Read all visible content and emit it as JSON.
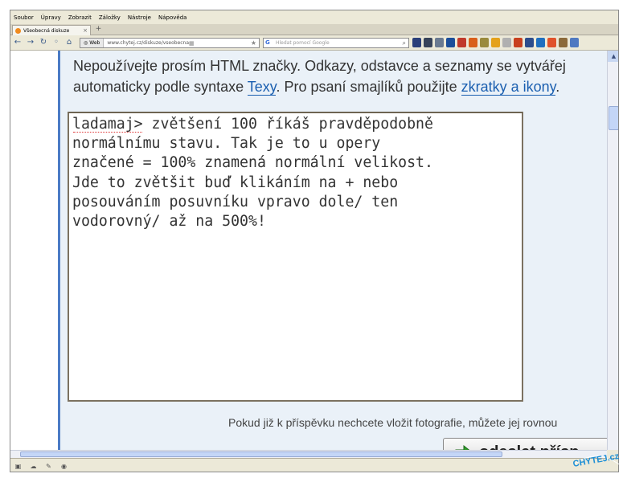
{
  "menu": [
    "Soubor",
    "Úpravy",
    "Zobrazit",
    "Záložky",
    "Nástroje",
    "Nápověda"
  ],
  "tab": {
    "title": "Všeobecná diskuze",
    "close": "×",
    "new": "+"
  },
  "nav": {
    "web_label": "Web",
    "url": "www.chytej.cz/diskuze/vseobecna",
    "search_placeholder": "Hledat pomocí Google"
  },
  "hint": {
    "line1": "Nepoužívejte prosím HTML značky. Odkazy, odstavce a seznamy se vytvářej",
    "line2_before": "automaticky podle syntaxe ",
    "texy_link": "Texy",
    "line2_middle": ". Pro psaní smajlíků použijte ",
    "smiley_link": "zkratky a ikony",
    "line2_after": "."
  },
  "editor": {
    "text": "ladamaj> zvětšení 100 říkáš pravděpodobně\nnormálnímu stavu. Tak je to u opery\nznačené = 100% znamená normální velikost.\nJde to zvětšit buď klikáním na + nebo\nposouváním posuvníku vpravo dole/ ten\nvodorovný/ až na 500%!"
  },
  "photo_note": "Pokud již k příspěvku nechcete vložit fotografie, můžete jej rovnou",
  "submit_label": "odeslat přísp",
  "logo_text": "CHYTEJ.cz",
  "colors": {
    "rail": "#4a7bc5",
    "content_bg": "#eaf1f8",
    "link": "#1b5fb0",
    "arrow": "#2e9e2a"
  }
}
